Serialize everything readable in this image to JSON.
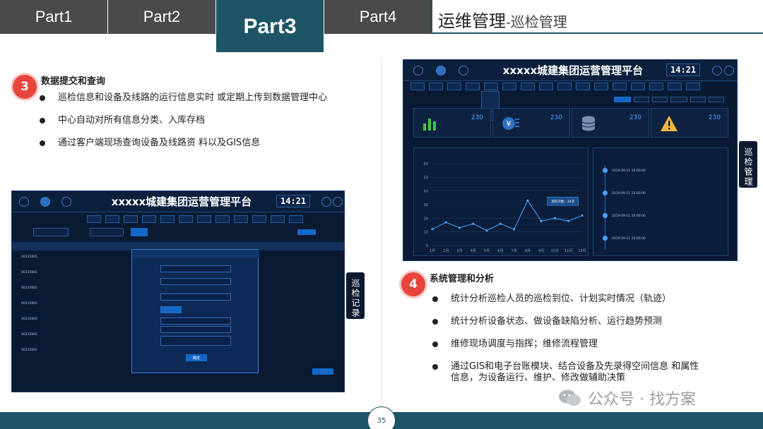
{
  "tabs": [
    {
      "label": "Part1"
    },
    {
      "label": "Part2"
    },
    {
      "label": "Part3"
    },
    {
      "label": "Part4"
    }
  ],
  "header": {
    "title": "运维管理",
    "subtitle": "-巡检管理"
  },
  "section3": {
    "number": "3",
    "title": "数据提交和查询",
    "bullets": [
      "巡检信息和设备及线路的运行信息实时 或定期上传到数据管理中心",
      "中心自动对所有信息分类、入库存档",
      "通过客户端现场查询设备及线路资 料以及GIS信息"
    ]
  },
  "section4": {
    "number": "4",
    "title": "系统管理和分析",
    "bullets": [
      "统计分析巡检人员的巡检到位、计划实时情况（轨迹）",
      "统计分析设备状态、做设备缺陷分析、运行趋势预测",
      "维修现场调度与指挥；维修流程管理",
      "通过GIS和电子台账模块、结合设备及先录得空间信息 和属性信息，为设备运行、维护、修改做辅助决策"
    ]
  },
  "dashboard_top": {
    "title": "xxxxx城建集团运营管理平台",
    "clock": "14:21",
    "stats": [
      {
        "value": "230",
        "icon": "bar-chart-icon"
      },
      {
        "value": "230",
        "icon": "yen-icon"
      },
      {
        "value": "230",
        "icon": "database-icon"
      },
      {
        "value": "230",
        "icon": "warning-icon"
      }
    ],
    "timeline": [
      {
        "date": "2019-09-11  10:00:00"
      },
      {
        "date": "2019-09-11  10:00:00"
      },
      {
        "date": "2019-09-11  10:00:00"
      },
      {
        "date": "2019-09-11  10:00:00"
      }
    ],
    "tooltip": "巡检次数：34次",
    "side_tag": "巡检管理"
  },
  "dashboard_bottom": {
    "title": "xxxxx城建集团运营管理平台",
    "clock": "14:21",
    "confirm_label": "确定",
    "rows": [
      {
        "id": "00235665"
      },
      {
        "id": "00235665"
      },
      {
        "id": "00235665"
      },
      {
        "id": "00235665"
      },
      {
        "id": "00235665"
      },
      {
        "id": "00235665"
      },
      {
        "id": "00235665"
      }
    ],
    "side_tag": "巡检记录"
  },
  "chart_data": {
    "type": "line",
    "title": "",
    "x": [
      "1月",
      "2月",
      "3月",
      "4月",
      "5月",
      "6月",
      "7月",
      "8月",
      "9月",
      "10月",
      "11月",
      "12月"
    ],
    "series": [
      {
        "values": [
          12,
          17,
          13,
          16,
          11,
          16,
          12,
          33,
          18,
          20,
          18,
          22
        ]
      }
    ],
    "ylim": [
      0,
      60
    ],
    "yticks": [
      0,
      10,
      20,
      30,
      40,
      50,
      60
    ]
  },
  "footer": {
    "page": "35"
  },
  "watermark": {
    "text": "公众号 · 找方案",
    "icon": "wechat-icon"
  },
  "colors": {
    "accent": "#1d5566",
    "badge": "#e8453c",
    "panel": "#0a1a33"
  }
}
